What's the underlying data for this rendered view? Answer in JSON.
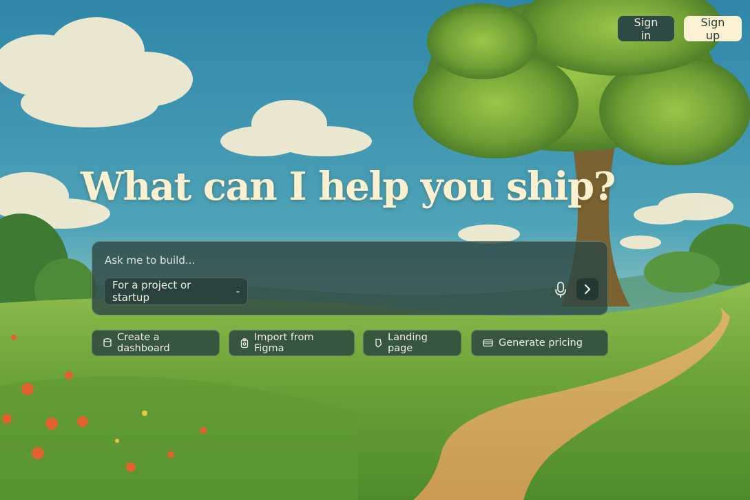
{
  "header": {
    "signin_label": "Sign in",
    "signup_label": "Sign up"
  },
  "hero": {
    "headline": "What can I help you ship?"
  },
  "prompt": {
    "placeholder": "Ask me to build...",
    "project_select": "For a project or startup",
    "project_select_chevron": "-",
    "mic_icon": "microphone-icon",
    "send_icon": "chevron-right-icon"
  },
  "suggestions": [
    {
      "label": "Create a dashboard",
      "icon": "database-icon"
    },
    {
      "label": "Import from Figma",
      "icon": "figma-icon"
    },
    {
      "label": "Landing page",
      "icon": "bookmark-icon"
    },
    {
      "label": "Generate pricing",
      "icon": "card-icon"
    }
  ],
  "colors": {
    "headline": "#fbf0cf",
    "signin_bg": "#2e4a45",
    "signup_bg": "#fbf1d2",
    "panel_bg": "#2d4642"
  }
}
